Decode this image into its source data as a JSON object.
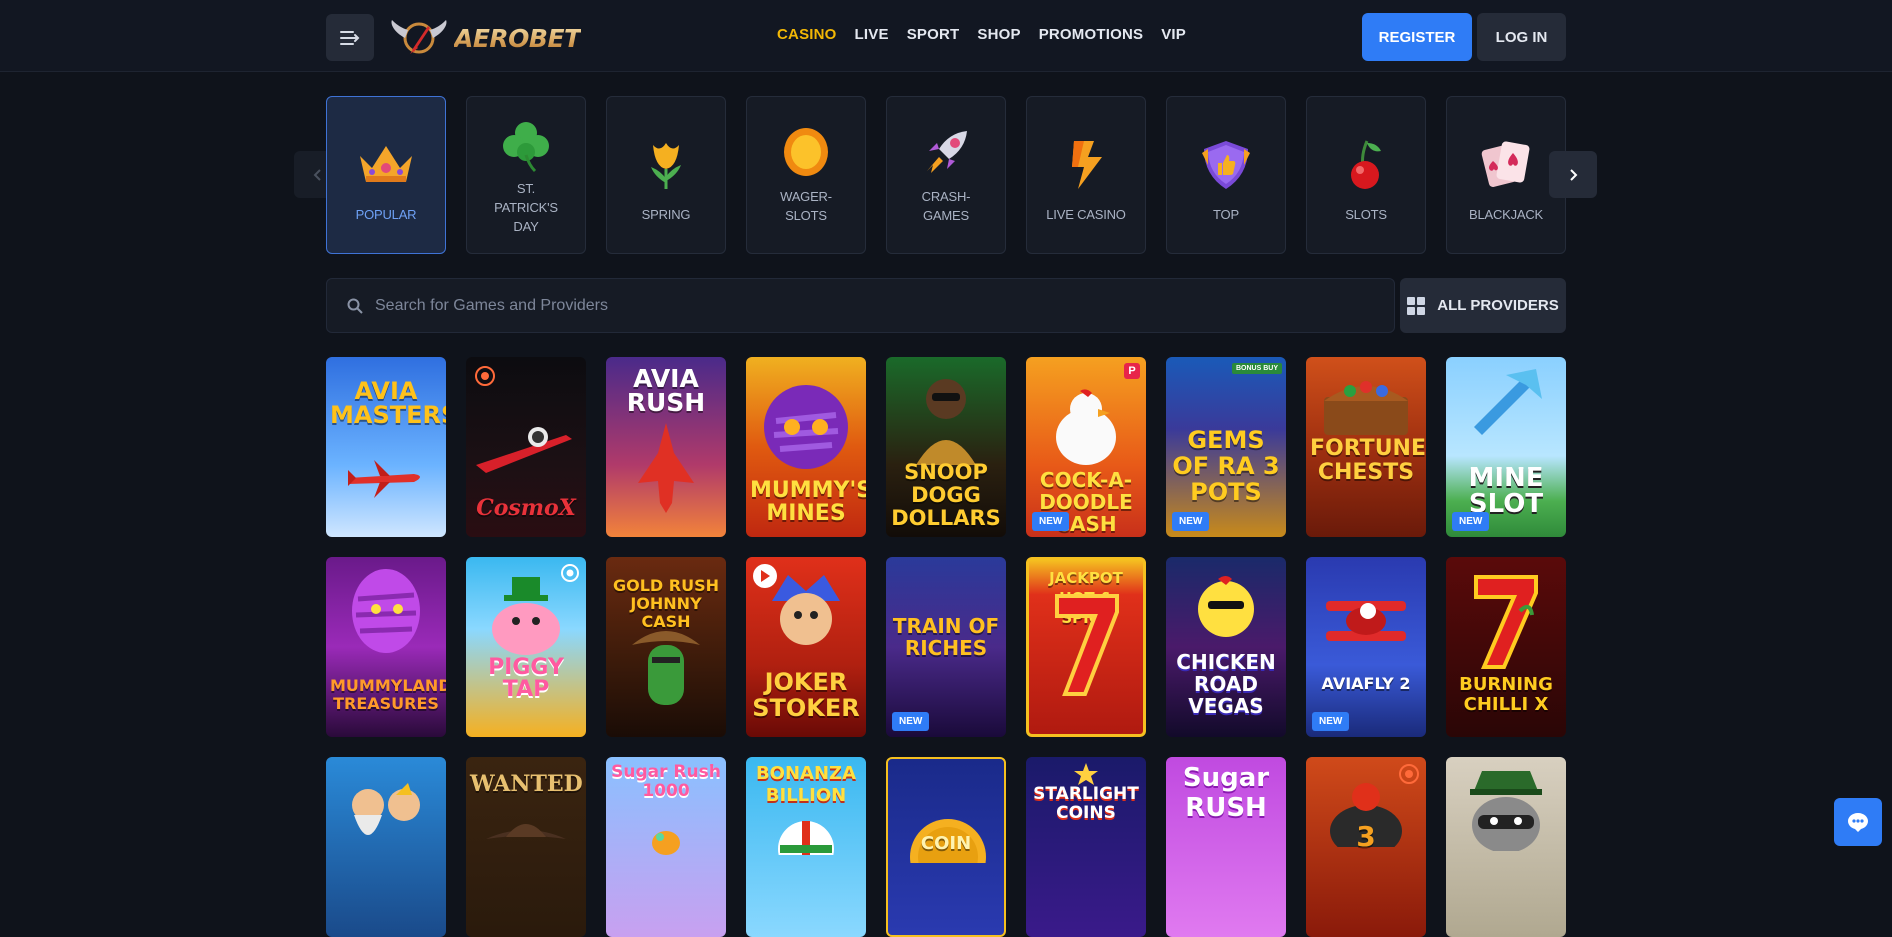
{
  "header": {
    "brand": "AEROBET",
    "nav": [
      "CASINO",
      "LIVE",
      "SPORT",
      "SHOP",
      "PROMOTIONS",
      "VIP"
    ],
    "active_nav": "CASINO",
    "register_label": "REGISTER",
    "login_label": "LOG IN"
  },
  "categories": [
    {
      "label": "POPULAR",
      "icon": "crown-icon",
      "active": true
    },
    {
      "label": "ST. PATRICK'S DAY",
      "icon": "clover-icon"
    },
    {
      "label": "SPRING",
      "icon": "tulip-icon"
    },
    {
      "label": "WAGER-SLOTS",
      "icon": "coin-icon"
    },
    {
      "label": "CRASH-GAMES",
      "icon": "rocket-icon"
    },
    {
      "label": "LIVE CASINO",
      "icon": "lightning-icon"
    },
    {
      "label": "TOP",
      "icon": "thumbs-up-shield-icon"
    },
    {
      "label": "SLOTS",
      "icon": "cherry-icon"
    },
    {
      "label": "BLACKJACK",
      "icon": "playing-cards-icon"
    }
  ],
  "search": {
    "placeholder": "Search for Games and Providers",
    "providers_label": "ALL PROVIDERS"
  },
  "games": [
    {
      "title": "AVIA MASTERS",
      "badge": ""
    },
    {
      "title": "CosmoX",
      "badge": ""
    },
    {
      "title": "AVIA RUSH",
      "badge": ""
    },
    {
      "title": "MUMMY'S MINES",
      "badge": ""
    },
    {
      "title": "SNOOP DOGG DOLLARS",
      "badge": ""
    },
    {
      "title": "COCK-A-DOODLE CASH",
      "badge": "NEW"
    },
    {
      "title": "GEMS OF RA 3 POTS",
      "badge": "NEW",
      "corner_label": "BONUS BUY"
    },
    {
      "title": "FORTUNE CHESTS",
      "badge": ""
    },
    {
      "title": "MINE SLOT",
      "badge": "NEW"
    },
    {
      "title": "MUMMYLAND TREASURES",
      "badge": ""
    },
    {
      "title": "PIGGY TAP",
      "badge": ""
    },
    {
      "title": "GOLD RUSH JOHNNY CASH",
      "badge": ""
    },
    {
      "title": "JOKER STOKER",
      "badge": ""
    },
    {
      "title": "TRAIN OF RICHES",
      "badge": "NEW"
    },
    {
      "title": "JACKPOT HOT & SPICY",
      "badge": ""
    },
    {
      "title": "CHICKEN ROAD VEGAS",
      "badge": ""
    },
    {
      "title": "AVIAFLY 2",
      "badge": "NEW"
    },
    {
      "title": "BURNING CHILLI X",
      "badge": ""
    },
    {
      "title": "",
      "badge": ""
    },
    {
      "title": "WANTED",
      "badge": ""
    },
    {
      "title": "Sugar Rush 1000",
      "badge": ""
    },
    {
      "title": "BONANZA BILLION",
      "badge": ""
    },
    {
      "title": "COIN",
      "badge": ""
    },
    {
      "title": "STARLIGHT COINS",
      "badge": ""
    },
    {
      "title": "Sugar RUSH",
      "badge": ""
    },
    {
      "title": "3",
      "badge": ""
    },
    {
      "title": "",
      "badge": ""
    }
  ],
  "colors": {
    "background": "#0f131b",
    "accent": "#2f7cf6",
    "active_nav": "#f2b705",
    "tile_bg": "#161b25"
  }
}
